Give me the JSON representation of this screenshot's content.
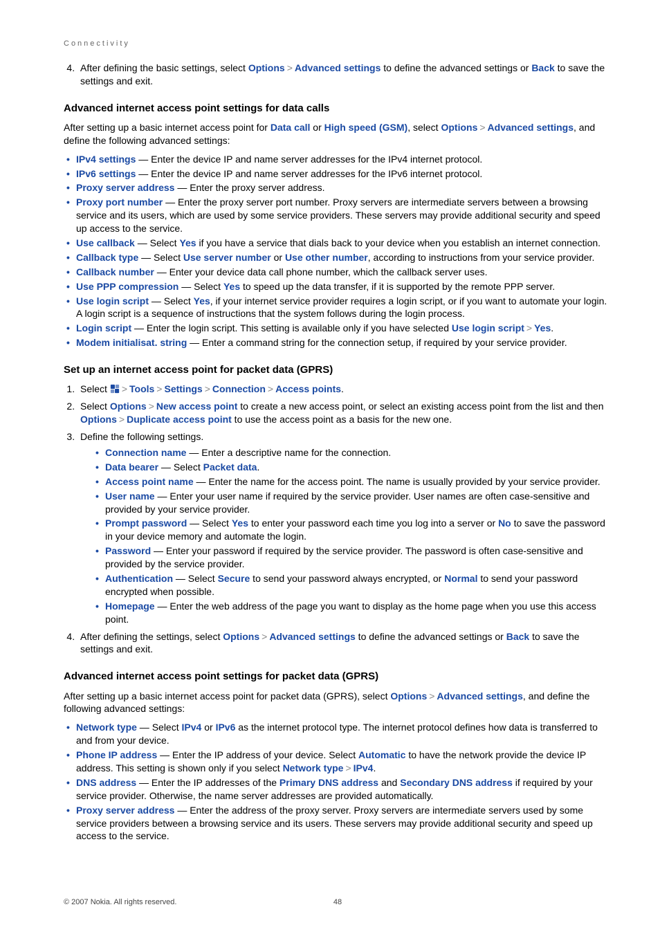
{
  "breadcrumb": "Connectivity",
  "step4_top": {
    "prefix": "After defining the basic settings, select ",
    "opt": "Options",
    "arrow1": ">",
    "adv": "Advanced settings",
    "mid": " to define the advanced settings or ",
    "back": "Back",
    "suffix": " to save the settings and exit."
  },
  "sec1_title": "Advanced internet access point settings for data calls",
  "sec1_intro": {
    "p1": "After setting up a basic internet access point for ",
    "datacall": "Data call",
    "or": " or ",
    "hs": "High speed (GSM)",
    "p2": ", select ",
    "opt": "Options",
    "arrow": ">",
    "adv": "Advanced settings",
    "p3": ", and define the following advanced settings:"
  },
  "sec1_items": [
    {
      "term": "IPv4 settings",
      "text": " — Enter the device IP and name server addresses for the IPv4 internet protocol."
    },
    {
      "term": "IPv6 settings",
      "text": " — Enter the device IP and name server addresses for the IPv6 internet protocol."
    },
    {
      "term": "Proxy server address",
      "text": " — Enter the proxy server address."
    },
    {
      "term": "Proxy port number",
      "text": " — Enter the proxy server port number. Proxy servers are intermediate servers between a browsing service and its users, which are used by some service providers. These servers may provide additional security and speed up access to the service."
    },
    {
      "term": "Use callback",
      "text_pre": " — Select ",
      "opt": "Yes",
      "text_post": " if you have a service that dials back to your device when you establish an internet connection."
    },
    {
      "term": "Callback type",
      "text_pre": " — Select ",
      "opt1": "Use server number",
      "or": " or ",
      "opt2": "Use other number",
      "text_post": ", according to instructions from your service provider."
    },
    {
      "term": "Callback number",
      "text": " — Enter your device data call phone number, which the callback server uses."
    },
    {
      "term": "Use PPP compression",
      "text_pre": " — Select ",
      "opt": "Yes",
      "text_post": " to speed up the data transfer, if it is supported by the remote PPP server."
    },
    {
      "term": "Use login script",
      "text_pre": " — Select ",
      "opt": "Yes",
      "text_post": ", if your internet service provider requires a login script, or if you want to automate your login. A login script is a sequence of instructions that the system follows during the login process."
    },
    {
      "term": "Login script",
      "text_pre": " — Enter the login script. This setting is available only if you have selected ",
      "opt1": "Use login script",
      "arrow": ">",
      "opt2": "Yes",
      "text_post": "."
    },
    {
      "term": "Modem initialisat. string",
      "text": " — Enter a command string for the connection setup, if required by your service provider."
    }
  ],
  "sec2_title": "Set up an internet access point for packet data (GPRS)",
  "sec2_step1": {
    "pre": "Select ",
    "m1": "Tools",
    "m2": "Settings",
    "m3": "Connection",
    "m4": "Access points",
    "arrow": ">"
  },
  "sec2_step2": {
    "pre": "Select ",
    "opt": "Options",
    "arrow": ">",
    "nap": "New access point",
    "mid": " to create a new access point, or select an existing access point from the list and then ",
    "opt2": "Options",
    "arrow2": ">",
    "dup": "Duplicate access point",
    "suf": " to use the access point as a basis for the new one."
  },
  "sec2_step3_label": "Define the following settings.",
  "sec2_sub": [
    {
      "term": "Connection name",
      "text": " — Enter a descriptive name for the connection."
    },
    {
      "term": "Data bearer",
      "text_pre": " — Select ",
      "opt": "Packet data",
      "text_post": "."
    },
    {
      "term": "Access point name",
      "text": " — Enter the name for the access point. The name is usually provided by your service provider."
    },
    {
      "term": "User name",
      "text": " — Enter your user name if required by the service provider. User names are often case-sensitive and provided by your service provider."
    },
    {
      "term": "Prompt password",
      "text_pre": " — Select ",
      "opt1": "Yes",
      "mid": " to enter your password each time you log into a server or ",
      "opt2": "No",
      "text_post": " to save the password in your device memory and automate the login."
    },
    {
      "term": "Password",
      "text": " — Enter your password if required by the service provider. The password is often case-sensitive and provided by the service provider."
    },
    {
      "term": "Authentication",
      "text_pre": " — Select ",
      "opt1": "Secure",
      "mid": " to send your password always encrypted, or ",
      "opt2": "Normal",
      "text_post": " to send your password encrypted when possible."
    },
    {
      "term": "Homepage",
      "text": " — Enter the web address of the page you want to display as the home page when you use this access point."
    }
  ],
  "sec2_step4": {
    "pre": "After defining the settings, select ",
    "opt": "Options",
    "arrow": ">",
    "adv": "Advanced settings",
    "mid": " to define the advanced settings or ",
    "back": "Back",
    "suf": " to save the settings and exit."
  },
  "sec3_title": "Advanced internet access point settings for packet data (GPRS)",
  "sec3_intro": {
    "p1": "After setting up a basic internet access point for packet data (GPRS), select ",
    "opt": "Options",
    "arrow": ">",
    "adv": "Advanced settings",
    "p2": ", and define the following advanced settings:"
  },
  "sec3_items": [
    {
      "term": "Network type",
      "text_pre": " — Select ",
      "opt1": "IPv4",
      "or": " or ",
      "opt2": "IPv6",
      "text_post": " as the internet protocol type. The internet protocol defines how data is transferred to and from your device."
    },
    {
      "term": "Phone IP address",
      "text_pre": " — Enter the IP address of your device. Select ",
      "opt1": "Automatic",
      "mid": " to have the network provide the device IP address. This setting is shown only if you select ",
      "opt2": "Network type",
      "arrow": ">",
      "opt3": "IPv4",
      "text_post": "."
    },
    {
      "term": "DNS address",
      "text_pre": " — Enter the IP addresses of the ",
      "opt1": "Primary DNS address",
      "and": " and ",
      "opt2": "Secondary DNS address",
      "text_post": " if required by your service provider. Otherwise, the name server addresses are provided automatically."
    },
    {
      "term": "Proxy server address",
      "text": " — Enter the address of the proxy server. Proxy servers are intermediate servers used by some service providers between a browsing service and its users. These servers may provide additional security and speed up access to the service."
    }
  ],
  "footer": {
    "copyright": "© 2007 Nokia. All rights reserved.",
    "page": "48"
  }
}
